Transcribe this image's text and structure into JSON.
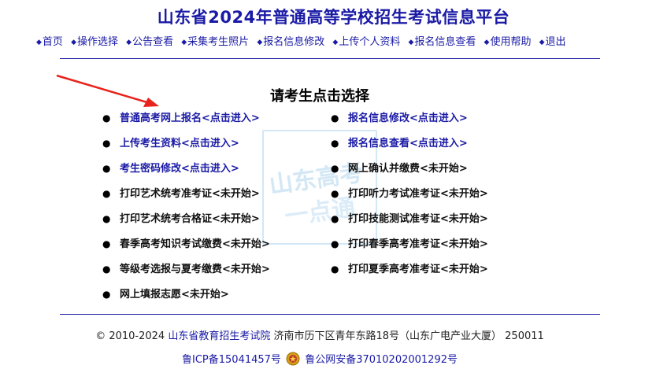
{
  "header": {
    "title": "山东省2024年普通高等学校招生考试信息平台"
  },
  "nav": {
    "items": [
      {
        "label": "首页"
      },
      {
        "label": "操作选择"
      },
      {
        "label": "公告查看"
      },
      {
        "label": "采集考生照片"
      },
      {
        "label": "报名信息修改"
      },
      {
        "label": "上传个人资料"
      },
      {
        "label": "报名信息查看"
      },
      {
        "label": "使用帮助"
      },
      {
        "label": "退出"
      }
    ]
  },
  "main": {
    "section_title": "请考生点击选择",
    "watermark_text": "山东高考一点通",
    "left_items": [
      {
        "label": "普通高考网上报名<点击进入>",
        "active": true
      },
      {
        "label": "上传考生资料<点击进入>",
        "active": true
      },
      {
        "label": "考生密码修改<点击进入>",
        "active": true
      },
      {
        "label": "打印艺术统考准考证<未开始>",
        "active": false
      },
      {
        "label": "打印艺术统考合格证<未开始>",
        "active": false
      },
      {
        "label": "春季高考知识考试缴费<未开始>",
        "active": false
      },
      {
        "label": "等级考选报与夏考缴费<未开始>",
        "active": false
      },
      {
        "label": "网上填报志愿<未开始>",
        "active": false
      }
    ],
    "right_items": [
      {
        "label": "报名信息修改<点击进入>",
        "active": true
      },
      {
        "label": "报名信息查看<点击进入>",
        "active": true
      },
      {
        "label": "网上确认并缴费<未开始>",
        "active": false
      },
      {
        "label": "打印听力考试准考证<未开始>",
        "active": false
      },
      {
        "label": "打印技能测试准考证<未开始>",
        "active": false
      },
      {
        "label": "打印春季高考准考证<未开始>",
        "active": false
      },
      {
        "label": "打印夏季高考准考证<未开始>",
        "active": false
      }
    ]
  },
  "footer": {
    "copyright": "© 2010-2024",
    "org_link": "山东省教育招生考试院",
    "address": "济南市历下区青年东路18号（山东广电产业大厦） 250011",
    "icp": "鲁ICP备15041457号",
    "police": "鲁公网安备37010202001292号"
  },
  "colors": {
    "accent": "#1a1aa6",
    "arrow": "#e8231c",
    "watermark": "#cfe5f5"
  }
}
